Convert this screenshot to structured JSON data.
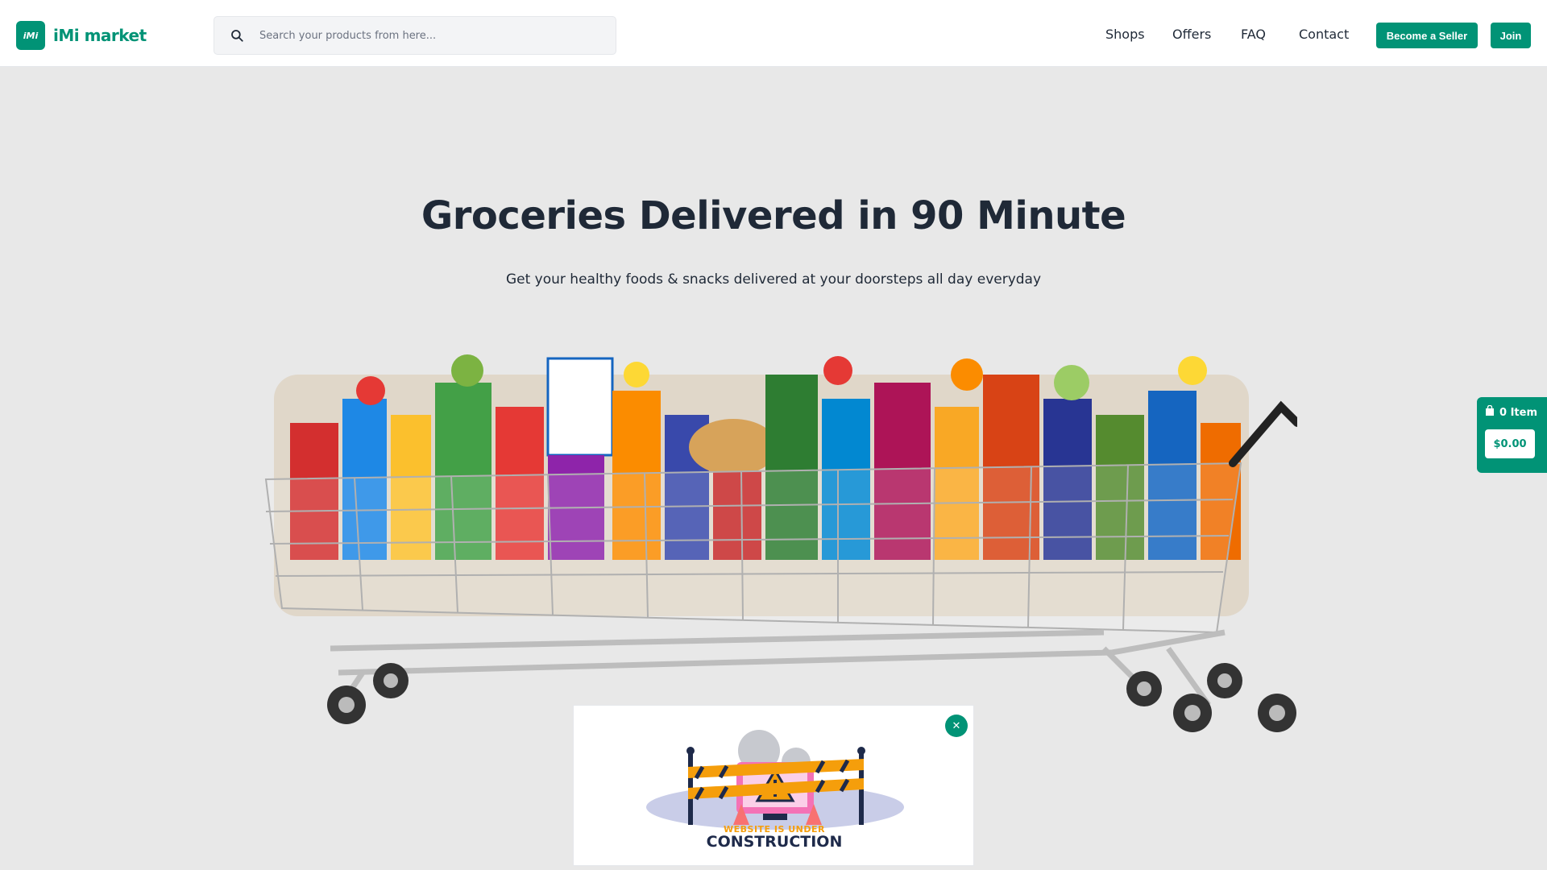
{
  "brand": {
    "mark": "iMi",
    "name": "iMi market",
    "color": "#019376"
  },
  "search": {
    "placeholder": "Search your products from here..."
  },
  "nav": {
    "links": [
      "Shops",
      "Offers",
      "FAQ",
      "Contact"
    ],
    "become_seller": "Become a Seller",
    "join": "Join"
  },
  "hero": {
    "title": "Groceries Delivered in 90 Minute",
    "subtitle": "Get your healthy foods & snacks delivered at your doorsteps all day everyday"
  },
  "cart_widget": {
    "count": "0 Item",
    "total": "$0.00",
    "icon": "shopping-bag-icon"
  },
  "popup": {
    "close_label": "✕",
    "small_text": "WEBSITE IS UNDER",
    "big_text": "CONSTRUCTION"
  }
}
